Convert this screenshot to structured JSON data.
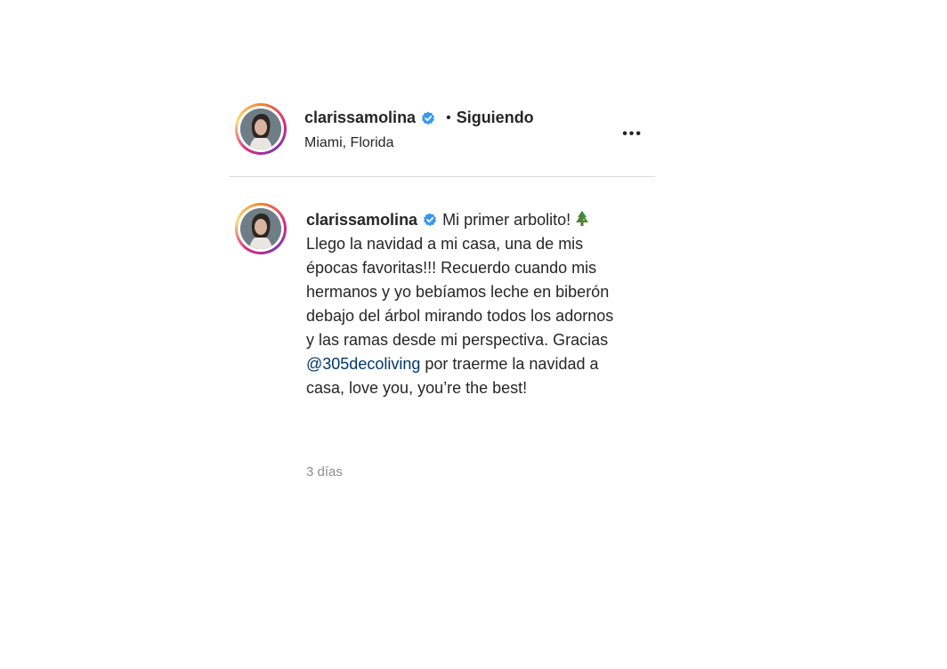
{
  "header": {
    "username": "clarissamolina",
    "separator": "•",
    "follow_status": "Siguiendo",
    "location": "Miami, Florida",
    "more_label": "•••"
  },
  "post": {
    "username": "clarissamolina",
    "caption_part1": "Mi primer arbolito!",
    "caption_part2": "Llego la navidad a mi casa, una de mis épocas favoritas!!! Recuerdo cuando mis hermanos y yo bebíamos leche en biberón debajo del árbol mirando todos los adornos y las ramas desde mi perspectiva. Gracias",
    "mention": "@305decoliving",
    "caption_part3": "por traerme la navidad a casa, love you, you’re the best!",
    "timestamp": "3 días"
  },
  "icons": {
    "verified": "verified-badge-icon",
    "tree": "christmas-tree-emoji",
    "more": "more-options-icon"
  },
  "colors": {
    "verified": "#3897f0",
    "mention": "#00376b",
    "timestamp": "#8e8e8e",
    "divider": "#dbdbdb"
  }
}
